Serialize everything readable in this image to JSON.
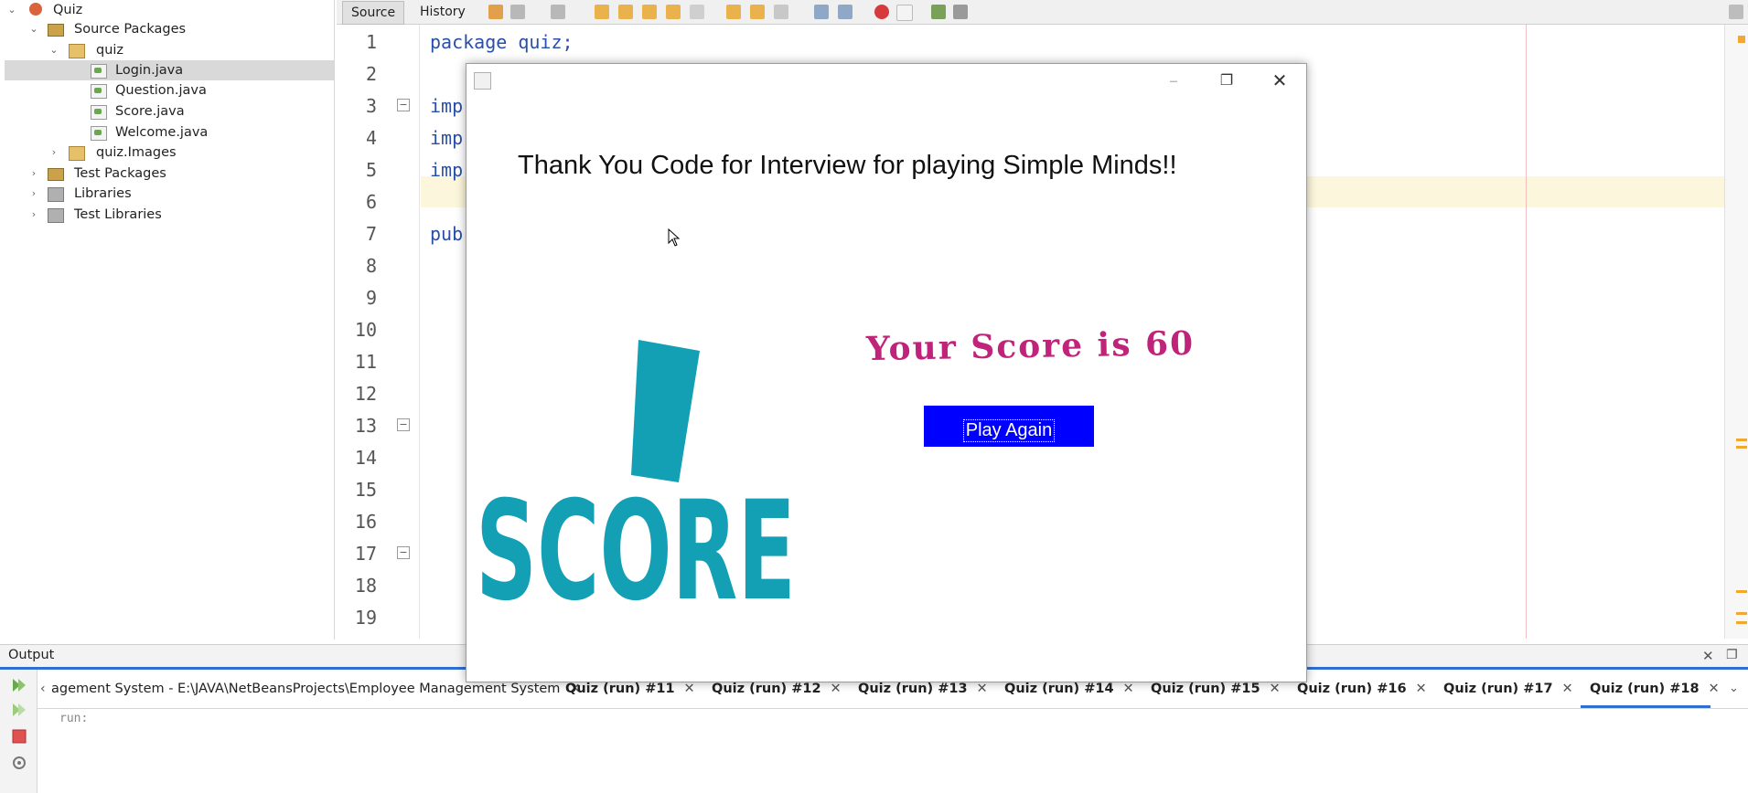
{
  "tree": {
    "project": "Quiz",
    "source_packages": "Source Packages",
    "package_quiz": "quiz",
    "files": [
      "Login.java",
      "Question.java",
      "Score.java",
      "Welcome.java"
    ],
    "package_images": "quiz.Images",
    "test_packages": "Test Packages",
    "libraries": "Libraries",
    "test_libraries": "Test Libraries"
  },
  "editor": {
    "tab_source": "Source",
    "tab_history": "History",
    "line_numbers": [
      "1",
      "2",
      "3",
      "4",
      "5",
      "6",
      "7",
      "8",
      "9",
      "10",
      "11",
      "12",
      "13",
      "14",
      "15",
      "16",
      "17",
      "18",
      "19"
    ],
    "code_lines": [
      "package quiz;",
      "",
      "imp",
      "imp",
      "imp",
      "",
      "pub"
    ]
  },
  "dialog": {
    "thanks": "Thank You Code for Interview for playing Simple Minds!!",
    "score_art_label": "SCORE",
    "score_text": "Your Score is 60",
    "play_again": "Play Again",
    "minimize": "–",
    "maximize": "❐",
    "close": "✕"
  },
  "output": {
    "title": "Output",
    "tabs": [
      "agement System - E:\\JAVA\\NetBeansProjects\\Employee Management System",
      "Quiz (run) #11",
      "Quiz (run) #12",
      "Quiz (run) #13",
      "Quiz (run) #14",
      "Quiz (run) #15",
      "Quiz (run) #16",
      "Quiz (run) #17",
      "Quiz (run) #18"
    ],
    "run_text": "run:"
  },
  "colors": {
    "play_button": "#0000ff",
    "score_text": "#c0237a",
    "score_art": "#13a0b5",
    "accent": "#2f6fcf"
  }
}
